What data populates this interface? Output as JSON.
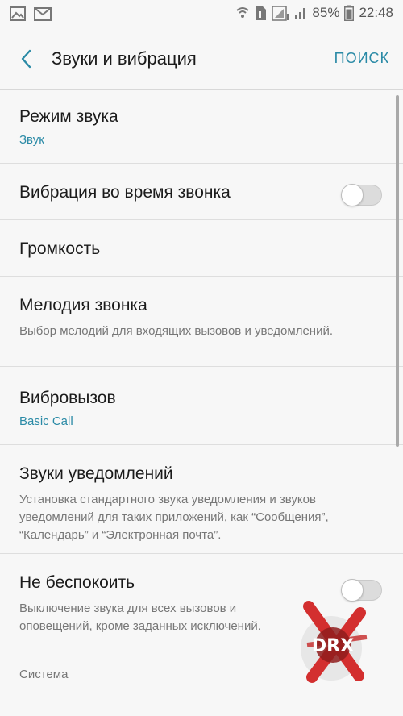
{
  "status_bar": {
    "left_icons": [
      "image-icon",
      "mail-icon"
    ],
    "right_icons": [
      "wifi-icon",
      "sim-icon",
      "signal-icon",
      "battery-icon"
    ],
    "battery": "85%",
    "time": "22:48"
  },
  "header": {
    "back_icon": "chevron-left-icon",
    "title": "Звуки и вибрация",
    "search_label": "ПОИСК"
  },
  "items": [
    {
      "title": "Режим звука",
      "subtitle": "Звук"
    },
    {
      "title": "Вибрация во время звонка",
      "toggle": false
    },
    {
      "title": "Громкость"
    },
    {
      "title": "Мелодия звонка",
      "description": "Выбор мелодий для входящих вызовов и уведомлений."
    },
    {
      "title": "Вибровызов",
      "subtitle": "Basic Call"
    },
    {
      "title": "Звуки уведомлений",
      "description": "Установка стандартного звука уведомления и звуков уведомлений для таких приложений, как “Сообщения”, “Календарь” и “Электронная почта”."
    },
    {
      "title": "Не беспокоить",
      "description": "Выключение звука для всех вызовов и оповещений, кроме заданных исключений.",
      "toggle": false
    }
  ],
  "section": {
    "label": "Система"
  },
  "colors": {
    "accent": "#2a8aa6",
    "background": "#f7f7f7",
    "watermark_red": "#d32f2f"
  },
  "watermark": {
    "text": "DRX",
    "description_icon": "drx-logo-icon"
  }
}
